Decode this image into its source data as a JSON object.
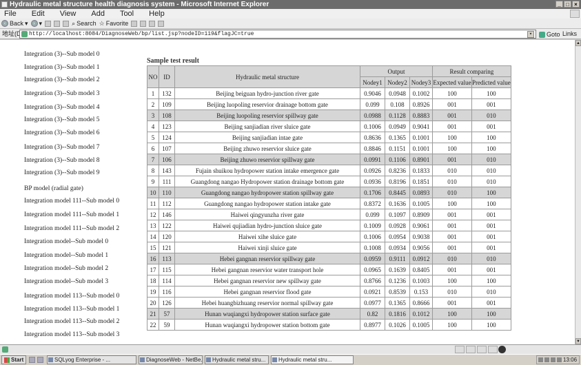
{
  "window": {
    "title": "Hydraulic metal structure health diagnosis system - Microsoft Internet Explorer"
  },
  "menu": [
    "File",
    "Edit",
    "View",
    "Add",
    "Tool",
    "Help"
  ],
  "toolbar": {
    "back": "Back",
    "search": "Search",
    "favorites": "Favorite"
  },
  "address": {
    "label": "地址(D)",
    "url": "http://localhost:8084/DiagnoseWeb/bp/list.jsp?nodeID=119&flagJC=true",
    "go": "Goto",
    "links": "Links"
  },
  "nav": [
    "Integration (3)--Sub model 0",
    "Integration (3)--Sub model 1",
    "Integration (3)--Sub model 2",
    "Integration (3)--Sub model 3",
    "Integration (3)--Sub model 4",
    "Integration (3)--Sub model 5",
    "Integration (3)--Sub model 6",
    "Integration (3)--Sub model 7",
    "Integration (3)--Sub model 8",
    "Integration (3)--Sub model 9",
    "BP model (radial gate)",
    "Integration model 111--Sub model 0",
    "Integration model 111--Sub model 1",
    "Integration model 111--Sub model 2",
    "Integration model--Sub model 0",
    "Integration model--Sub model 1",
    "Integration model--Sub model 2",
    "Integration model--Sub model 3",
    "Integration model 113--Sub model 0",
    "Integration model 113--Sub model 1",
    "Integration model 113--Sub model 2",
    "Integration model 113--Sub model 3"
  ],
  "results": {
    "title": "Sample test result",
    "headers": {
      "no": "NO",
      "id": "ID",
      "structure": "Hydraulic metal structure",
      "output": "Output",
      "comparing": "Result comparing",
      "node1": "Nodey1",
      "node2": "Nodey2",
      "node3": "Nodey3",
      "expected": "Expected value",
      "predicted": "Predicted value"
    },
    "rows": [
      [
        "1",
        "132",
        "Beijing beiguan hydro-junction river gate",
        "0.9046",
        "0.0948",
        "0.1002",
        "100",
        "100"
      ],
      [
        "2",
        "109",
        "Beijing luopoling reservior drainage bottom gate",
        "0.099",
        "0.108",
        "0.8926",
        "001",
        "001"
      ],
      [
        "3",
        "108",
        "Beijing luopoling reservior spillway gate",
        "0.0988",
        "0.1128",
        "0.8883",
        "001",
        "010"
      ],
      [
        "4",
        "123",
        "Beijing sanjiadian river sluice gate",
        "0.1006",
        "0.0949",
        "0.9041",
        "001",
        "001"
      ],
      [
        "5",
        "124",
        "Beijing sanjiadian intae gate",
        "0.8636",
        "0.1365",
        "0.1001",
        "100",
        "100"
      ],
      [
        "6",
        "107",
        "Beijing zhuwo reservior sluice gate",
        "0.8846",
        "0.1151",
        "0.1001",
        "100",
        "100"
      ],
      [
        "7",
        "106",
        "Beijing zhuwo reservior spillway gate",
        "0.0991",
        "0.1106",
        "0.8901",
        "001",
        "010"
      ],
      [
        "8",
        "143",
        "Fujain shuikou hydropower station intake emergence gate",
        "0.0926",
        "0.8236",
        "0.1833",
        "010",
        "010"
      ],
      [
        "9",
        "111",
        "Guangdong nangao Hydropower station drainage bottom gate",
        "0.0936",
        "0.8196",
        "0.1851",
        "010",
        "010"
      ],
      [
        "10",
        "110",
        "Guangdong nangao hydropower station spillway gate",
        "0.1706",
        "0.8445",
        "0.0893",
        "010",
        "100"
      ],
      [
        "11",
        "112",
        "Guangdong nangao hydropower station intake gate",
        "0.8372",
        "0.1636",
        "0.1005",
        "100",
        "100"
      ],
      [
        "12",
        "146",
        "Haiwei qingyunzha river gate",
        "0.099",
        "0.1097",
        "0.8909",
        "001",
        "001"
      ],
      [
        "13",
        "122",
        "Haiwei qujiadian hydro-junction sluice gate",
        "0.1009",
        "0.0928",
        "0.9061",
        "001",
        "001"
      ],
      [
        "14",
        "120",
        "Haiwei xihe sluice gate",
        "0.1006",
        "0.0954",
        "0.9038",
        "001",
        "001"
      ],
      [
        "15",
        "121",
        "Haiwei xinji sluice gate",
        "0.1008",
        "0.0934",
        "0.9056",
        "001",
        "001"
      ],
      [
        "16",
        "113",
        "Hebei gangnan reservior spillway gate",
        "0.0959",
        "0.9111",
        "0.0912",
        "010",
        "010"
      ],
      [
        "17",
        "115",
        "Hebei gangnan reservior water transport hole",
        "0.0965",
        "0.1639",
        "0.8405",
        "001",
        "001"
      ],
      [
        "18",
        "114",
        "Hebei gangnan reservior new spillway gate",
        "0.8766",
        "0.1236",
        "0.1003",
        "100",
        "100"
      ],
      [
        "19",
        "116",
        "Hebei gangnan reservior flood gate",
        "0.0921",
        "0.8539",
        "0.153",
        "010",
        "010"
      ],
      [
        "20",
        "126",
        "Hebei huangbizhuang reservior normal spillway gate",
        "0.0977",
        "0.1365",
        "0.8666",
        "001",
        "001"
      ],
      [
        "21",
        "57",
        "Hunan wuqiangxi hydropower station surface gate",
        "0.82",
        "0.1816",
        "0.1012",
        "100",
        "100"
      ],
      [
        "22",
        "59",
        "Hunan wuqiangxi hydropower station bottom gate",
        "0.8977",
        "0.1026",
        "0.1005",
        "100",
        "100"
      ]
    ],
    "shaded_rows": [
      3,
      7,
      10,
      16,
      21
    ]
  },
  "taskbar": {
    "start": "Start",
    "tasks": [
      "SQLyog Enterprise - ...",
      "DiagnoseWeb - NetBe...",
      "Hydraulic metal stru...",
      "Hydraulic metal stru..."
    ],
    "clock": "13:06"
  }
}
